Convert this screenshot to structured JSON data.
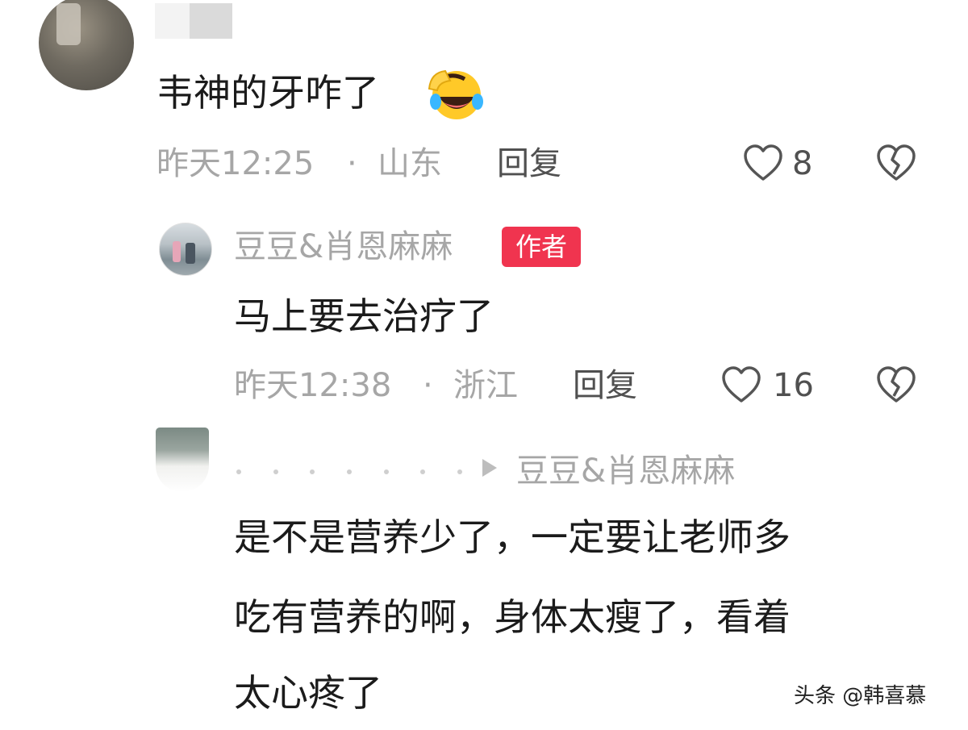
{
  "comments": [
    {
      "text": "韦神的牙咋了",
      "time": "昨天12:25",
      "location": "山东",
      "reply_label": "回复",
      "likes": "8"
    },
    {
      "username": "豆豆&肖恩麻麻",
      "badge": "作者",
      "text": "马上要去治疗了",
      "time": "昨天12:38",
      "location": "浙江",
      "reply_label": "回复",
      "likes": "16"
    },
    {
      "reply_to": "豆豆&肖恩麻麻",
      "text_lines": [
        "是不是营养少了，一定要让老师多",
        "吃有营养的啊，身体太瘦了，看着",
        "太心疼了"
      ]
    }
  ],
  "separator": "·",
  "watermark": "头条 @韩喜慕",
  "colors": {
    "text": "#1b1b1b",
    "meta": "#a6a6a6",
    "badge": "#f0344f"
  },
  "icons": [
    "heart-outline-icon",
    "broken-heart-icon",
    "laughing-crying-emoji",
    "reply-arrow-icon"
  ]
}
